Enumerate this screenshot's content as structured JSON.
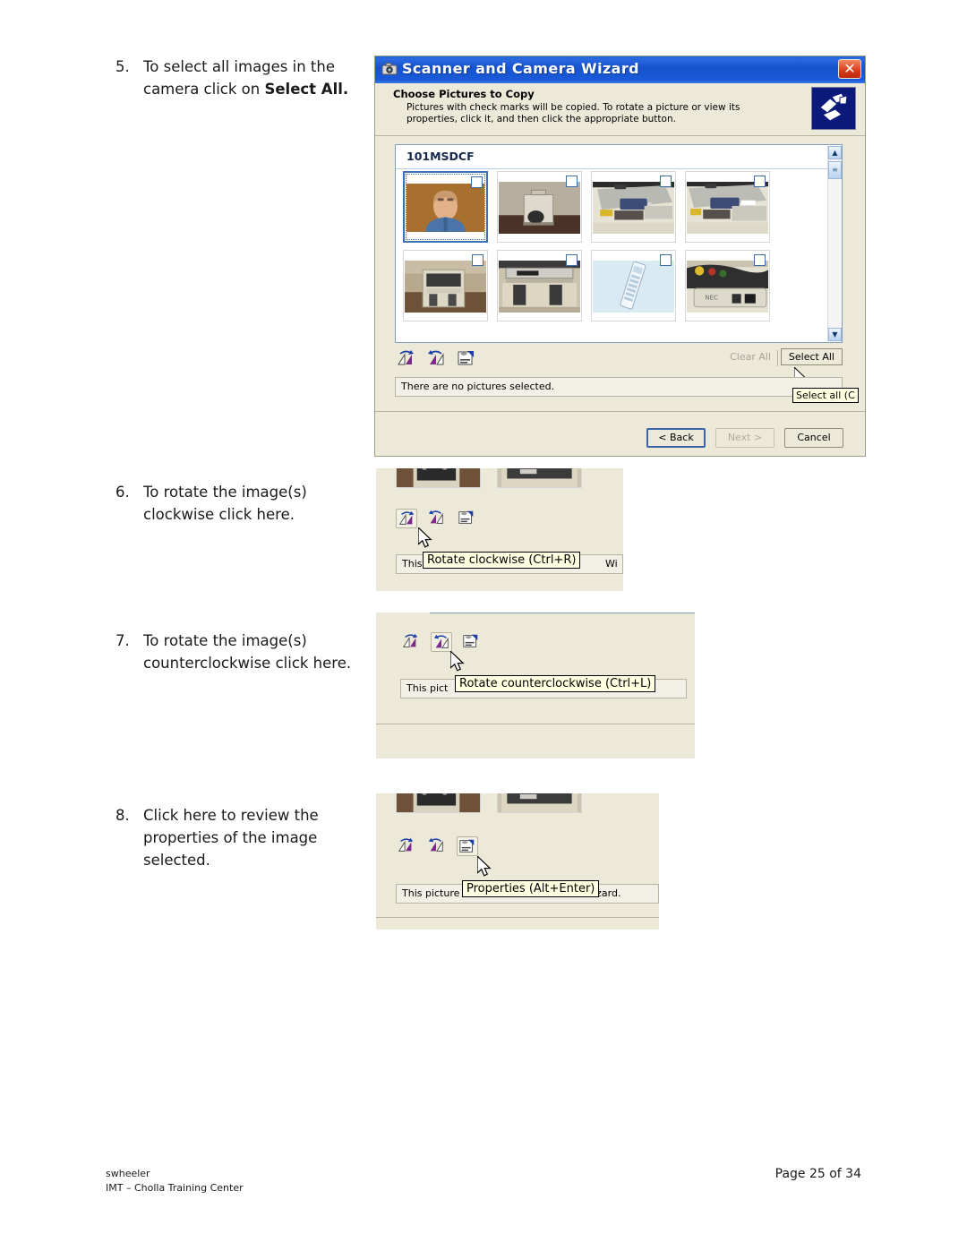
{
  "document": {
    "steps": [
      {
        "number": "5.",
        "text_plain": "To select all images in the camera click on ",
        "bold_tail": "Select All."
      },
      {
        "number": "6.",
        "text_plain": "To rotate the image(s) clockwise click here."
      },
      {
        "number": "7.",
        "text_plain": "To rotate the image(s) counterclockwise click here."
      },
      {
        "number": "8.",
        "text_plain": "Click here to review the properties of the image selected."
      }
    ],
    "footer": {
      "author": "swheeler",
      "org": "IMT – Cholla Training Center",
      "page": "Page 25 of 34"
    }
  },
  "wizard": {
    "title": "Scanner and Camera Wizard",
    "title_icon": "camera-icon",
    "close_label": "✕",
    "header": {
      "heading": "Choose Pictures to Copy",
      "description": "Pictures with check marks will be copied. To rotate a picture or view its properties, click it, and then click the appropriate button.",
      "icon": "scanner-camera-banner-icon"
    },
    "folder": {
      "name": "101MSDCF"
    },
    "thumbnails": {
      "row1": [
        {
          "alt": "portrait-of-man",
          "selected": true,
          "checked": false
        },
        {
          "alt": "projector-on-cart",
          "selected": false,
          "checked": false
        },
        {
          "alt": "projector-closeup-1",
          "selected": false,
          "checked": false
        },
        {
          "alt": "projector-closeup-2",
          "selected": false,
          "checked": false
        }
      ],
      "row2": [
        {
          "alt": "av-cart-front",
          "selected": false,
          "checked": false
        },
        {
          "alt": "av-cart-equipment",
          "selected": false,
          "checked": false
        },
        {
          "alt": "remote-control",
          "selected": false,
          "checked": false
        },
        {
          "alt": "nec-projector-cables",
          "selected": false,
          "checked": false
        }
      ]
    },
    "toolbar": {
      "rotate_cw": "rotate-clockwise-icon",
      "rotate_ccw": "rotate-counterclockwise-icon",
      "properties": "properties-icon",
      "clear_all": "Clear All",
      "select_all": "Select All"
    },
    "status_text": "There are no pictures selected.",
    "tooltip_select_all": "Select all (C",
    "buttons": {
      "back": "< Back",
      "next": "Next >",
      "cancel": "Cancel"
    },
    "scrollbar": {
      "up": "▲",
      "down": "▼",
      "grip": "≡"
    }
  },
  "clip_step6": {
    "tooltip": "Rotate clockwise (Ctrl+R)",
    "status_left": "This",
    "status_right": "Wi",
    "active_icon": "rotate-clockwise-icon"
  },
  "clip_step7": {
    "tooltip": "Rotate counterclockwise (Ctrl+L)",
    "status_left": "This pict",
    "active_icon": "rotate-counterclockwise-icon"
  },
  "clip_step8": {
    "tooltip": "Properties (Alt+Enter)",
    "status_full": "This picture cannot be rotated in the wizard.",
    "status_left": "This picture c",
    "status_right": "ard.",
    "active_icon": "properties-icon"
  },
  "colors": {
    "titlebar_blue": "#1653cf",
    "window_beige": "#ece9d8",
    "tooltip_yellow": "#ffffe1",
    "close_red": "#d9391a",
    "selection_blue": "#3f6fb5"
  }
}
